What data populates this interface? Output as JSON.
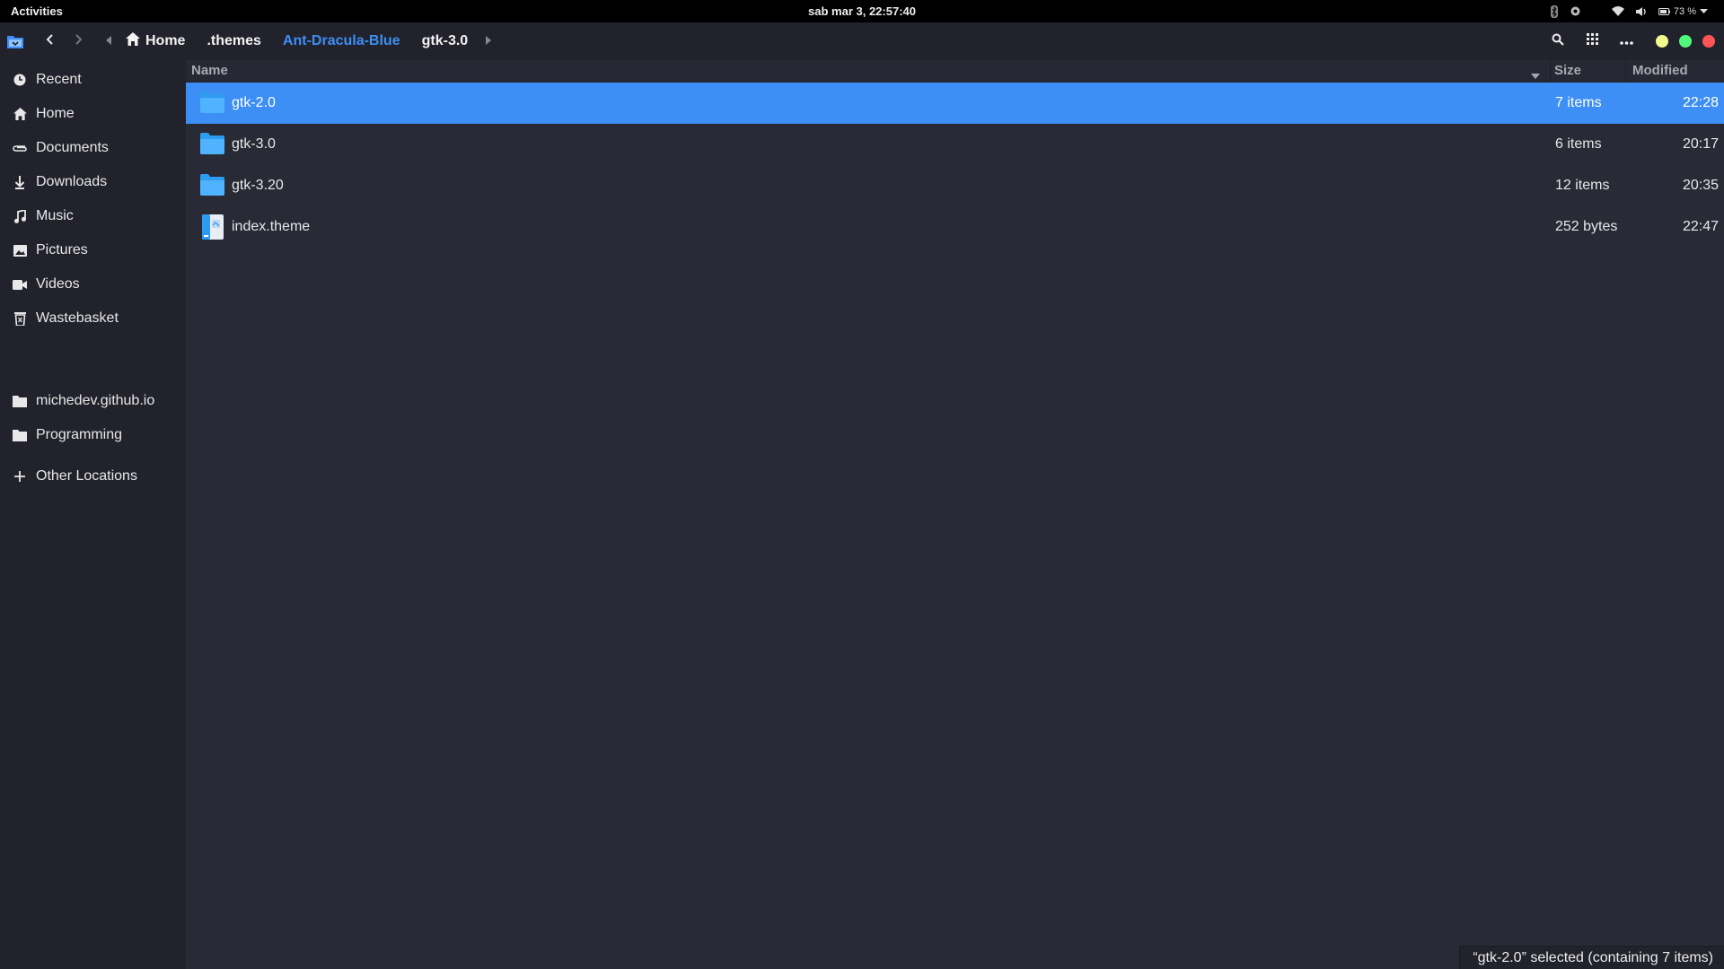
{
  "topbar": {
    "activities": "Activities",
    "clock": "sab mar  3, 22:57:40",
    "battery": "73 %"
  },
  "header": {
    "breadcrumbs": [
      {
        "label": "Home",
        "icon": "home-icon"
      },
      {
        "label": ".themes"
      },
      {
        "label": "Ant-Dracula-Blue"
      },
      {
        "label": "gtk-3.0"
      }
    ]
  },
  "sidebar": {
    "places": [
      {
        "label": "Recent",
        "icon": "clock-icon"
      },
      {
        "label": "Home",
        "icon": "home-icon"
      },
      {
        "label": "Documents",
        "icon": "paperclip-icon"
      },
      {
        "label": "Downloads",
        "icon": "download-icon"
      },
      {
        "label": "Music",
        "icon": "music-note-icon"
      },
      {
        "label": "Pictures",
        "icon": "image-icon"
      },
      {
        "label": "Videos",
        "icon": "video-camera-icon"
      },
      {
        "label": "Wastebasket",
        "icon": "trash-icon"
      }
    ],
    "bookmarks": [
      {
        "label": "michedev.github.io",
        "icon": "folder-icon"
      },
      {
        "label": "Programming",
        "icon": "folder-icon"
      }
    ],
    "other": {
      "label": "Other Locations",
      "icon": "plus-icon"
    }
  },
  "list": {
    "columns": {
      "name": "Name",
      "size": "Size",
      "modified": "Modified"
    },
    "rows": [
      {
        "name": "gtk-2.0",
        "size": "7 items",
        "modified": "22:28",
        "type": "folder",
        "selected": true
      },
      {
        "name": "gtk-3.0",
        "size": "6 items",
        "modified": "20:17",
        "type": "folder",
        "selected": false
      },
      {
        "name": "gtk-3.20",
        "size": "12 items",
        "modified": "20:35",
        "type": "folder",
        "selected": false
      },
      {
        "name": "index.theme",
        "size": "252 bytes",
        "modified": "22:47",
        "type": "file",
        "selected": false
      }
    ]
  },
  "status": {
    "text": "“gtk-2.0” selected (containing 7 items)"
  },
  "colors": {
    "accent": "#3d8ff5",
    "window_bg": "#282a36",
    "sidebar_bg": "#21222c",
    "minimize": "#f1fa8c",
    "maximize": "#50fa7b",
    "close": "#ff5555"
  }
}
